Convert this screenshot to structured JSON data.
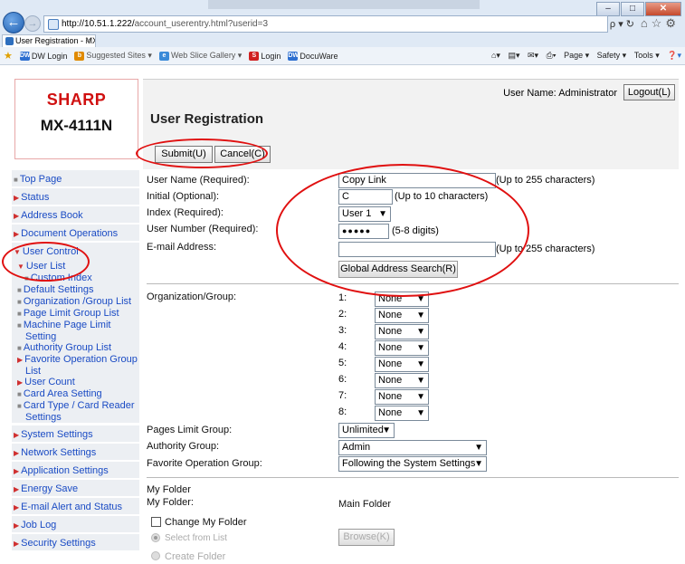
{
  "browser": {
    "url_host": "http://10.51.1.222/",
    "url_path": "account_userentry.html?userid=3",
    "tab_title": "User Registration - MX-411...",
    "search_hint": "ρ ▾ ↻",
    "favorites": [
      "DW Login",
      "Suggested Sites ▾",
      "Web Slice Gallery ▾",
      "Login",
      "DocuWare"
    ],
    "commands": [
      "Page ▾",
      "Safety ▾",
      "Tools ▾"
    ]
  },
  "brand": "SHARP",
  "model": "MX-4111N",
  "header": {
    "user_label": "User Name: Administrator",
    "logout": "Logout(L)",
    "title": "User Registration",
    "submit": "Submit(U)",
    "cancel": "Cancel(C)"
  },
  "sidebar": {
    "items": [
      "Top Page",
      "Status",
      "Address Book",
      "Document Operations",
      "User Control"
    ],
    "user_control_sub": [
      "User List",
      "Custom Index",
      "Default Settings",
      "Organization /Group List",
      "Page Limit Group List",
      "Machine Page Limit",
      "Setting",
      "Authority Group List",
      "Favorite Operation Group",
      "List",
      "User Count",
      "Card Area Setting",
      "Card Type / Card Reader",
      "Settings"
    ],
    "bottom_items": [
      "System Settings",
      "Network Settings",
      "Application Settings",
      "Energy Save",
      "E-mail Alert and Status",
      "Job Log",
      "Security Settings"
    ]
  },
  "form": {
    "user_name_label": "User Name (Required):",
    "user_name_value": "Copy Link",
    "user_name_hint": "(Up to 255 characters)",
    "initial_label": "Initial (Optional):",
    "initial_value": "C",
    "initial_hint": "(Up to 10 characters)",
    "index_label": "Index (Required):",
    "index_value": "User 1",
    "user_number_label": "User Number (Required):",
    "user_number_value": "●●●●●",
    "user_number_hint": "(5-8 digits)",
    "email_label": "E-mail Address:",
    "email_value": "",
    "email_hint": "(Up to 255 characters)",
    "global_search": "Global Address Search(R)",
    "org_label": "Organization/Group:",
    "org_rows": [
      {
        "num": "1:",
        "value": "None"
      },
      {
        "num": "2:",
        "value": "None"
      },
      {
        "num": "3:",
        "value": "None"
      },
      {
        "num": "4:",
        "value": "None"
      },
      {
        "num": "5:",
        "value": "None"
      },
      {
        "num": "6:",
        "value": "None"
      },
      {
        "num": "7:",
        "value": "None"
      },
      {
        "num": "8:",
        "value": "None"
      }
    ],
    "pages_limit_label": "Pages Limit Group:",
    "pages_limit_value": "Unlimited",
    "authority_label": "Authority Group:",
    "authority_value": "Admin",
    "favorite_label": "Favorite Operation Group:",
    "favorite_value": "Following the System Settings",
    "my_folder_section": "My Folder",
    "my_folder_label": "My Folder:",
    "my_folder_value": "Main Folder",
    "change_my_folder": "Change My Folder",
    "select_from_list": "Select from List",
    "browse": "Browse(K)",
    "create_folder": "Create Folder"
  },
  "colors": {
    "annotation_red": "#e01010",
    "brand_red": "#d01010",
    "link_blue": "#1a4bc4",
    "sidebar_bg": "#eceff3"
  }
}
